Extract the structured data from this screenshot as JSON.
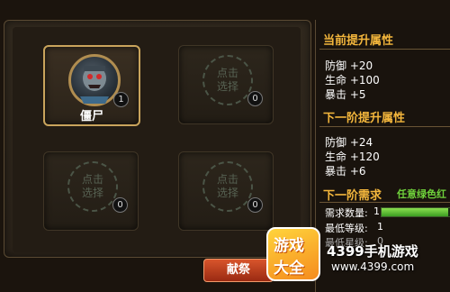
{
  "slots": [
    {
      "name": "僵尸",
      "count": "1",
      "state": "filled"
    },
    {
      "hint_line1": "点击",
      "hint_line2": "选择",
      "count": "0",
      "state": "empty"
    },
    {
      "hint_line1": "点击",
      "hint_line2": "选择",
      "count": "0",
      "state": "empty"
    },
    {
      "hint_line1": "点击",
      "hint_line2": "选择",
      "count": "0",
      "state": "empty"
    }
  ],
  "panel": {
    "current_title": "当前提升属性",
    "current_stats": [
      "防御 +20",
      "生命 +100",
      "暴击 +5"
    ],
    "next_title": "下一阶提升属性",
    "next_stats": [
      "防御 +24",
      "生命 +120",
      "暴击 +6"
    ],
    "req_title": "下一阶需求",
    "req_subtitle": "任意绿色红",
    "req_count_label": "需求数量:",
    "req_count_value": "1",
    "req_progress": 0.95,
    "req_min_level_label": "最低等级:",
    "req_min_level_value": "1",
    "req_min_star_label": "最低星级:",
    "req_min_star_value": "0"
  },
  "donate_label": "献祭",
  "watermark": {
    "logo_line1": "游戏",
    "logo_line2": "大全",
    "name": "4399手机游戏",
    "url": "www.4399.com"
  },
  "colors": {
    "accent": "#f3b63c",
    "req_green": "#6fd13b",
    "donate": "#c9441f"
  }
}
